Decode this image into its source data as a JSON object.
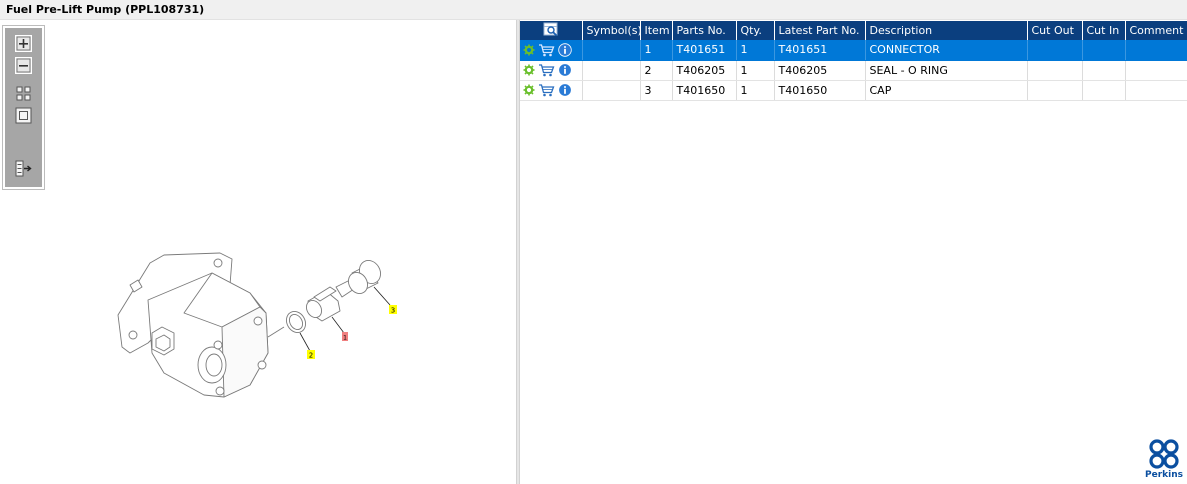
{
  "window": {
    "title": "Fuel Pre-Lift Pump (PPL108731)"
  },
  "toolbox": {
    "icons": [
      "zoom-in-icon",
      "zoom-out-icon",
      "fit-all-icon",
      "fit-window-icon",
      "export-list-icon"
    ]
  },
  "drawing": {
    "callouts": [
      {
        "label": "3",
        "color": "#ffff00"
      },
      {
        "label": "2",
        "color": "#ffff00"
      },
      {
        "label": "1",
        "color": "#f08080"
      }
    ]
  },
  "table": {
    "columns": [
      "Symbol(s)",
      "Item",
      "Parts No.",
      "Qty.",
      "Latest Part No.",
      "Description",
      "Cut Out",
      "Cut In",
      "Comment"
    ],
    "rows": [
      {
        "item": "1",
        "parts_no": "T401651",
        "qty": "1",
        "latest": "T401651",
        "desc": "CONNECTOR",
        "cut_out": "",
        "cut_in": "",
        "comment": ""
      },
      {
        "item": "2",
        "parts_no": "T406205",
        "qty": "1",
        "latest": "T406205",
        "desc": "SEAL - O RING",
        "cut_out": "",
        "cut_in": "",
        "comment": ""
      },
      {
        "item": "3",
        "parts_no": "T401650",
        "qty": "1",
        "latest": "T401650",
        "desc": "CAP",
        "cut_out": "",
        "cut_in": "",
        "comment": ""
      }
    ],
    "selected_row": 0
  },
  "brand": {
    "name": "Perkins",
    "color": "#0b4fa0"
  },
  "colors": {
    "header": "#0b3f7f",
    "selection": "#0078d7",
    "gear": "#6abf2b",
    "info": "#2a7bd6"
  }
}
